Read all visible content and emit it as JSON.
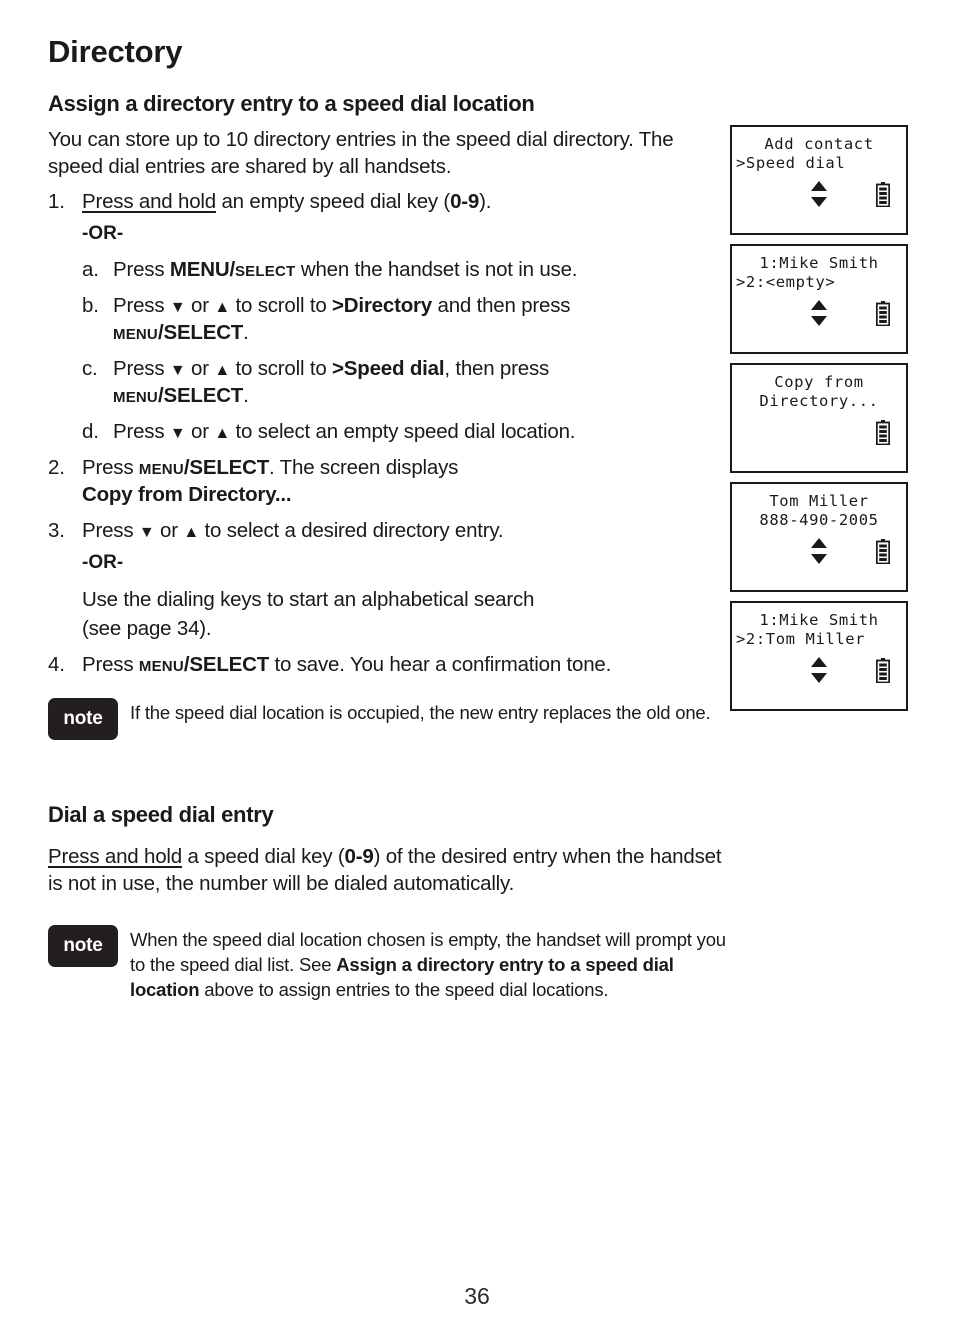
{
  "page": {
    "chapter_title": "Directory",
    "folio": "36"
  },
  "section1": {
    "heading": "Assign a directory entry to a speed dial location",
    "intro": "You can store up to 10 directory entries in the speed dial directory. The speed dial entries are shared by all handsets.",
    "or_label": "-OR-",
    "steps": {
      "s1_marker": "1.",
      "s1_lead": "Press and hold",
      "s1_rest_a": " an empty speed dial key (",
      "s1_keys": "0-9",
      "s1_rest_b": ").",
      "sa_marker": "a.",
      "sa_pre": "Press ",
      "sa_key_big": "MENU/",
      "sa_key_small": "SELECT",
      "sa_post": " when the handset is not in use.",
      "sb_marker": "b.",
      "sb_pre": "Press ",
      "sb_or": " or ",
      "sb_mid": " to scroll to ",
      "sb_target": ">Directory",
      "sb_post": " and then press ",
      "sb_key_small": "MENU",
      "sb_key_big": "/SELECT",
      "sb_end": ".",
      "sc_marker": "c.",
      "sc_pre": "Press ",
      "sc_or": " or ",
      "sc_mid": " to scroll to ",
      "sc_target": ">Speed dial",
      "sc_post": ", then press ",
      "sc_key_small": "MENU",
      "sc_key_big": "/SELECT",
      "sc_end": ".",
      "sd_marker": "d.",
      "sd_pre": "Press ",
      "sd_or": " or ",
      "sd_post": " to select an empty speed dial location.",
      "s2_marker": "2.",
      "s2_pre": "Press ",
      "s2_key_small": "MENU",
      "s2_key_big": "/SELECT",
      "s2_post": ". The screen displays",
      "s2_bold": "Copy from Directory...",
      "s3_marker": "3.",
      "s3_pre": "Press ",
      "s3_or": " or ",
      "s3_post": " to select a desired directory entry.",
      "s3_or_label": "-OR-",
      "s3_alt_line1": "Use the dialing keys to start an alphabetical search",
      "s3_alt_line2": "(see page 34).",
      "s4_marker": "4.",
      "s4_pre": "Press ",
      "s4_key_small": "MENU",
      "s4_key_big": "/SELECT",
      "s4_post": " to save. You hear a confirmation tone."
    },
    "note": {
      "badge": "note",
      "text": "If the speed dial location is occupied, the new entry replaces the old one."
    }
  },
  "section2": {
    "heading": "Dial a speed dial entry",
    "body_lead": "Press and hold",
    "body_a": " a speed dial key (",
    "body_keys": "0-9",
    "body_b": ") of the desired entry when the handset is not in use, the number will be dialed automatically.",
    "note": {
      "badge": "note",
      "text_a": "When the speed dial location chosen is empty, the handset will prompt you to the speed dial list. See ",
      "text_bold": "Assign a directory entry to a speed dial location",
      "text_b": " above to assign entries to the speed dial locations."
    }
  },
  "lcd_screens": [
    {
      "line1": "Add contact",
      "line2": ">Speed dial",
      "line2_align": "left",
      "show_updown": true,
      "show_battery": true
    },
    {
      "line1": "1:Mike Smith",
      "line2": ">2:<empty>",
      "line2_align": "left",
      "show_updown": true,
      "show_battery": true
    },
    {
      "line1": "Copy from",
      "line2": "Directory...",
      "line2_align": "center",
      "show_updown": false,
      "show_battery": true
    },
    {
      "line1": "Tom Miller",
      "line2": "888-490-2005",
      "line2_align": "center",
      "show_updown": true,
      "show_battery": true
    },
    {
      "line1": "1:Mike Smith",
      "line2": ">2:Tom Miller",
      "line2_align": "left",
      "show_updown": true,
      "show_battery": true
    }
  ],
  "icons": {
    "down_triangle": "▼",
    "up_triangle": "▲",
    "updown": "updown-arrow-icon",
    "battery": "battery-icon"
  },
  "colors": {
    "text": "#1a1a1a",
    "note_badge_bg": "#231f20",
    "lcd_border": "#1a1a1a"
  }
}
